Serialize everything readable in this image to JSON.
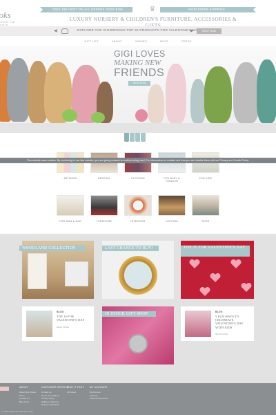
{
  "header": {
    "logo_word": "ooks",
    "logo_sub": "MAKING THE WORLD",
    "ribbon_left": "FREE DELIVERY ON ALL ORDERS OVER $150",
    "ribbon_right": "WORLDWIDE SHIPPING",
    "crown_glyph": "♛",
    "tagline": "LUXURY NURSERY & CHILDREN'S FURNITURE, ACCESSORIES & GIFTS"
  },
  "promo": {
    "prev": "◀",
    "next": "▶",
    "text": "EXPLORE THE GIGIBROOKS TOP 25 PRODUCTS FOR VALENTINE'S DAY!",
    "button": "SHOP NOW"
  },
  "nav": [
    "GIFT LIST",
    "ABOUT",
    "WISHES",
    "BLOG",
    "PRESS"
  ],
  "hero": {
    "line1": "GIGI LOVES",
    "line2": "MAKING NEW",
    "line3": "FRIENDS",
    "button": "SHOP NOW"
  },
  "cookie": "This website uses cookies. By continuing to use this website, you are giving consent to cookies being used. For information on cookies and how you can disable them visit our Privacy and Cookie Policy.",
  "categories": [
    {
      "label": "ARTWORK"
    },
    {
      "label": "BEDDING"
    },
    {
      "label": "CLOTHING"
    },
    {
      "label": "FOR BABY & TODDLER"
    },
    {
      "label": "FOR KIDS"
    },
    {
      "label": "FOR MUM & DAD"
    },
    {
      "label": "FURNITURE"
    },
    {
      "label": "INTERIORS"
    },
    {
      "label": "LIGHTING"
    },
    {
      "label": "RUGS"
    }
  ],
  "features": {
    "woodland": "WOODLAND COLLECTION",
    "last_chance": "LAST CHANCE TO BUY!",
    "valentine": "TOP 25 FOR VALENTINE'S DAY",
    "giftshop": "IN STOCK GIFT SHOP"
  },
  "blog_left": {
    "kicker": "BLOG",
    "title": "TOP 10 FOR VALENTINE'S DAY",
    "more": "READ MORE"
  },
  "blog_right": {
    "kicker": "BLOG",
    "title": "5 FUN WAYS TO CELEBRATE VALENTINE'S DAY WITH KIDS",
    "more": "READ MORE"
  },
  "footer": {
    "col1": {
      "head": "ABOUT",
      "items": [
        "About Gigi Brooks",
        "Press",
        "Contact Us",
        "Blog Links"
      ]
    },
    "col2": {
      "head": "CUSTOMER SERVICE",
      "items": [
        "Contact us",
        "Terms & Conditions",
        "Privacy Policy",
        "Delivery & Returns",
        "Returns & Refunds"
      ]
    },
    "col3": {
      "head": "FIND IT FAST",
      "items": [
        "Gift Ideas"
      ]
    },
    "col4": {
      "head": "MY ACCOUNT",
      "items": [
        "My Account",
        "Gift Lists",
        "Password Reminder"
      ]
    },
    "copyright": "© COPYRIGHT GIGI BROOKS 2014"
  },
  "colors": {
    "accent": "#a9c6c9",
    "footer": "#8b8f92",
    "feature_bg": "#e2e2e2"
  }
}
